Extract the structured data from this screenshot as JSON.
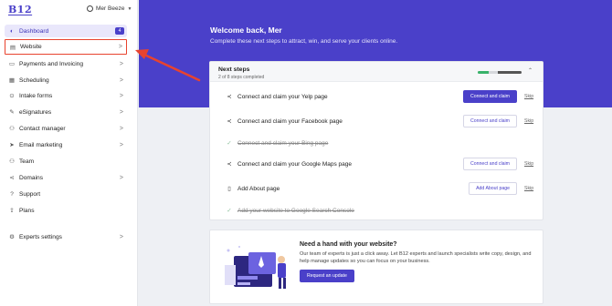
{
  "brand": {
    "logo": "B12",
    "accent": "#4a40c9",
    "annotation_color": "#e8432e"
  },
  "user": {
    "name": "Mer Beeze",
    "icon": "user-circle-icon"
  },
  "sidebar": {
    "items": [
      {
        "label": "Dashboard",
        "icon": "dashboard-icon",
        "badge": "4",
        "active": true
      },
      {
        "label": "Website",
        "icon": "website-icon",
        "chevron": ">",
        "highlighted": true
      },
      {
        "label": "Payments and Invoicing",
        "icon": "payments-icon",
        "chevron": ">"
      },
      {
        "label": "Scheduling",
        "icon": "calendar-icon",
        "chevron": ">"
      },
      {
        "label": "Intake forms",
        "icon": "forms-icon",
        "chevron": ">"
      },
      {
        "label": "eSignatures",
        "icon": "signature-icon",
        "chevron": ">"
      },
      {
        "label": "Contact manager",
        "icon": "contacts-icon",
        "chevron": ">"
      },
      {
        "label": "Email marketing",
        "icon": "email-icon",
        "chevron": ">"
      },
      {
        "label": "Team",
        "icon": "team-icon"
      },
      {
        "label": "Domains",
        "icon": "domains-icon",
        "chevron": ">"
      },
      {
        "label": "Support",
        "icon": "support-icon"
      },
      {
        "label": "Plans",
        "icon": "plans-icon"
      },
      {
        "label": "Experts settings",
        "icon": "gear-icon",
        "chevron": ">"
      }
    ]
  },
  "hero": {
    "title": "Welcome back, Mer",
    "subtitle": "Complete these next steps to attract, win, and serve your clients online."
  },
  "next_steps": {
    "title": "Next steps",
    "subtitle": "2 of 8 steps completed",
    "progress": 0.25,
    "steps": [
      {
        "label": "Connect and claim your Yelp page",
        "icon": "share-icon",
        "button": "Connect and claim",
        "primary": true,
        "skip": "Skip"
      },
      {
        "label": "Connect and claim your Facebook page",
        "icon": "share-icon",
        "button": "Connect and claim",
        "skip": "Skip"
      },
      {
        "label": "Connect and claim your Bing page",
        "icon": "check-icon",
        "done": true
      },
      {
        "label": "Connect and claim your Google Maps page",
        "icon": "share-icon",
        "button": "Connect and claim",
        "skip": "Skip"
      },
      {
        "label": "Add About page",
        "icon": "page-icon",
        "button": "Add About page",
        "skip": "Skip"
      },
      {
        "label": "Add your website to Google Search Console",
        "icon": "check-icon",
        "done": true
      }
    ]
  },
  "help": {
    "title": "Need a hand with your website?",
    "text": "Our team of experts is just a click away. Let B12 experts and launch specialists write copy, design, and help manage updates so you can focus on your business.",
    "button": "Request an update"
  }
}
